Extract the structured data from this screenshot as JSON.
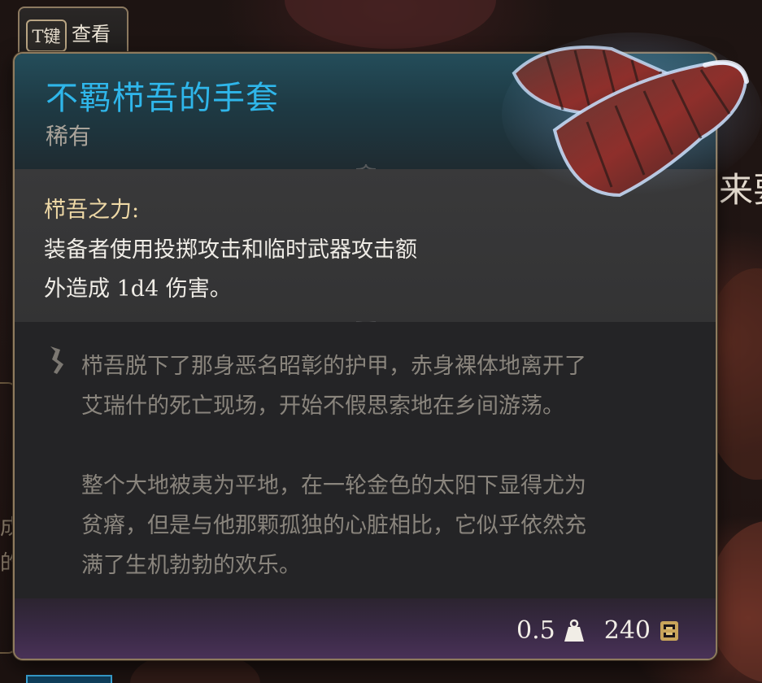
{
  "key_hint": {
    "key": "T键",
    "label": "查看"
  },
  "item": {
    "name": "不羁栉吾的手套",
    "rarity": "稀有",
    "effect_title": "栉吾之力:",
    "effect_lines": [
      "装备者使用投掷攻击和临时武器攻击额",
      "外造成 1d4 伤害。"
    ],
    "lore_paragraphs": [
      [
        "栉吾脱下了那身恶名昭彰的护甲，赤身裸体地离开了",
        "艾瑞什的死亡现场，开始不假思索地在乡间游荡。"
      ],
      [
        "整个大地被夷为平地，在一轮金色的太阳下显得尤为",
        "贫瘠，但是与他那颗孤独的心脏相比，它似乎依然充",
        "满了生机勃勃的欢乐。"
      ]
    ],
    "weight": "0.5",
    "value": "240",
    "icons": {
      "weight": "weight-icon",
      "value": "gold-coin-icon",
      "lore": "quill-icon",
      "art": "gloves-icon"
    }
  },
  "background": {
    "right_text": "来要",
    "left_text_1": "成",
    "left_text_2": "的"
  },
  "colors": {
    "name": "#2fb6ea",
    "rarity": "#a9a39a",
    "effect_title": "#efd9a6",
    "lore": "#8a857d",
    "border": "#8f7b5e"
  }
}
